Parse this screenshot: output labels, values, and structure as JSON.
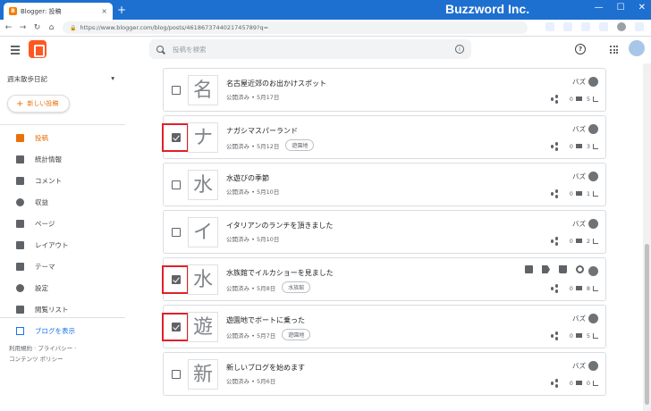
{
  "browser": {
    "tab_title": "Blogger: 投稿",
    "tab_close": "×",
    "new_tab": "+",
    "brand_overlay": "Buzzword Inc.",
    "url": "https://www.blogger.com/blog/posts/461867374402174578​9?q=",
    "window_min": "—",
    "window_max": "☐",
    "window_close": "✕",
    "nav_back": "←",
    "nav_forward": "→",
    "nav_reload": "↻",
    "nav_home": "⌂"
  },
  "header": {
    "search_placeholder": "投稿を検索",
    "help": "?",
    "info": "i"
  },
  "sidebar": {
    "blog_name": "週末散歩日記",
    "dropdown": "▾",
    "new_post_plus": "+",
    "new_post_label": "新しい投稿",
    "items": [
      {
        "label": "投稿",
        "icon": "posts-icon"
      },
      {
        "label": "統計情報",
        "icon": "stats-icon"
      },
      {
        "label": "コメント",
        "icon": "comment-icon"
      },
      {
        "label": "収益",
        "icon": "dollar-icon"
      },
      {
        "label": "ページ",
        "icon": "pages-icon"
      },
      {
        "label": "レイアウト",
        "icon": "layout-icon"
      },
      {
        "label": "テーマ",
        "icon": "theme-icon"
      },
      {
        "label": "設定",
        "icon": "gear-icon"
      },
      {
        "label": "閲覧リスト",
        "icon": "bookmark-icon"
      }
    ],
    "view_blog": "ブログを表示",
    "footer_line1": "利用規約 · プライバシー ·",
    "footer_line2": "コンテンツ ポリシー"
  },
  "posts": [
    {
      "thumb": "名",
      "title": "名古屋近郊のお出かけスポット",
      "meta": "公開済み • 5月17日",
      "label": "",
      "author": "バズ",
      "comments": "0",
      "views": "5",
      "checked": false
    },
    {
      "thumb": "ナ",
      "title": "ナガシマスパーランド",
      "meta": "公開済み • 5月12日",
      "label": "遊園地",
      "author": "バズ",
      "comments": "0",
      "views": "3",
      "checked": true
    },
    {
      "thumb": "水",
      "title": "水遊びの季節",
      "meta": "公開済み • 5月10日",
      "label": "",
      "author": "バズ",
      "comments": "0",
      "views": "1",
      "checked": false
    },
    {
      "thumb": "イ",
      "title": "イタリアンのランチを頂きました",
      "meta": "公開済み • 5月10日",
      "label": "",
      "author": "バズ",
      "comments": "0",
      "views": "2",
      "checked": false
    },
    {
      "thumb": "水",
      "title": "水族館でイルカショーを見ました",
      "meta": "公開済み • 5月8日",
      "label": "水族館",
      "author": "",
      "comments": "0",
      "views": "8",
      "checked": true
    },
    {
      "thumb": "遊",
      "title": "遊園地でボートに乗った",
      "meta": "公開済み • 5月7日",
      "label": "遊園地",
      "author": "バズ",
      "comments": "0",
      "views": "5",
      "checked": true
    },
    {
      "thumb": "新",
      "title": "新しいブログを始めます",
      "meta": "公開済み • 5月6日",
      "label": "",
      "author": "バズ",
      "comments": "0",
      "views": "0",
      "checked": false
    }
  ],
  "colors": {
    "accent": "#e8710a",
    "brand_bar": "#1d6fd0",
    "highlight": "#e0202a",
    "link": "#1a73e8"
  }
}
